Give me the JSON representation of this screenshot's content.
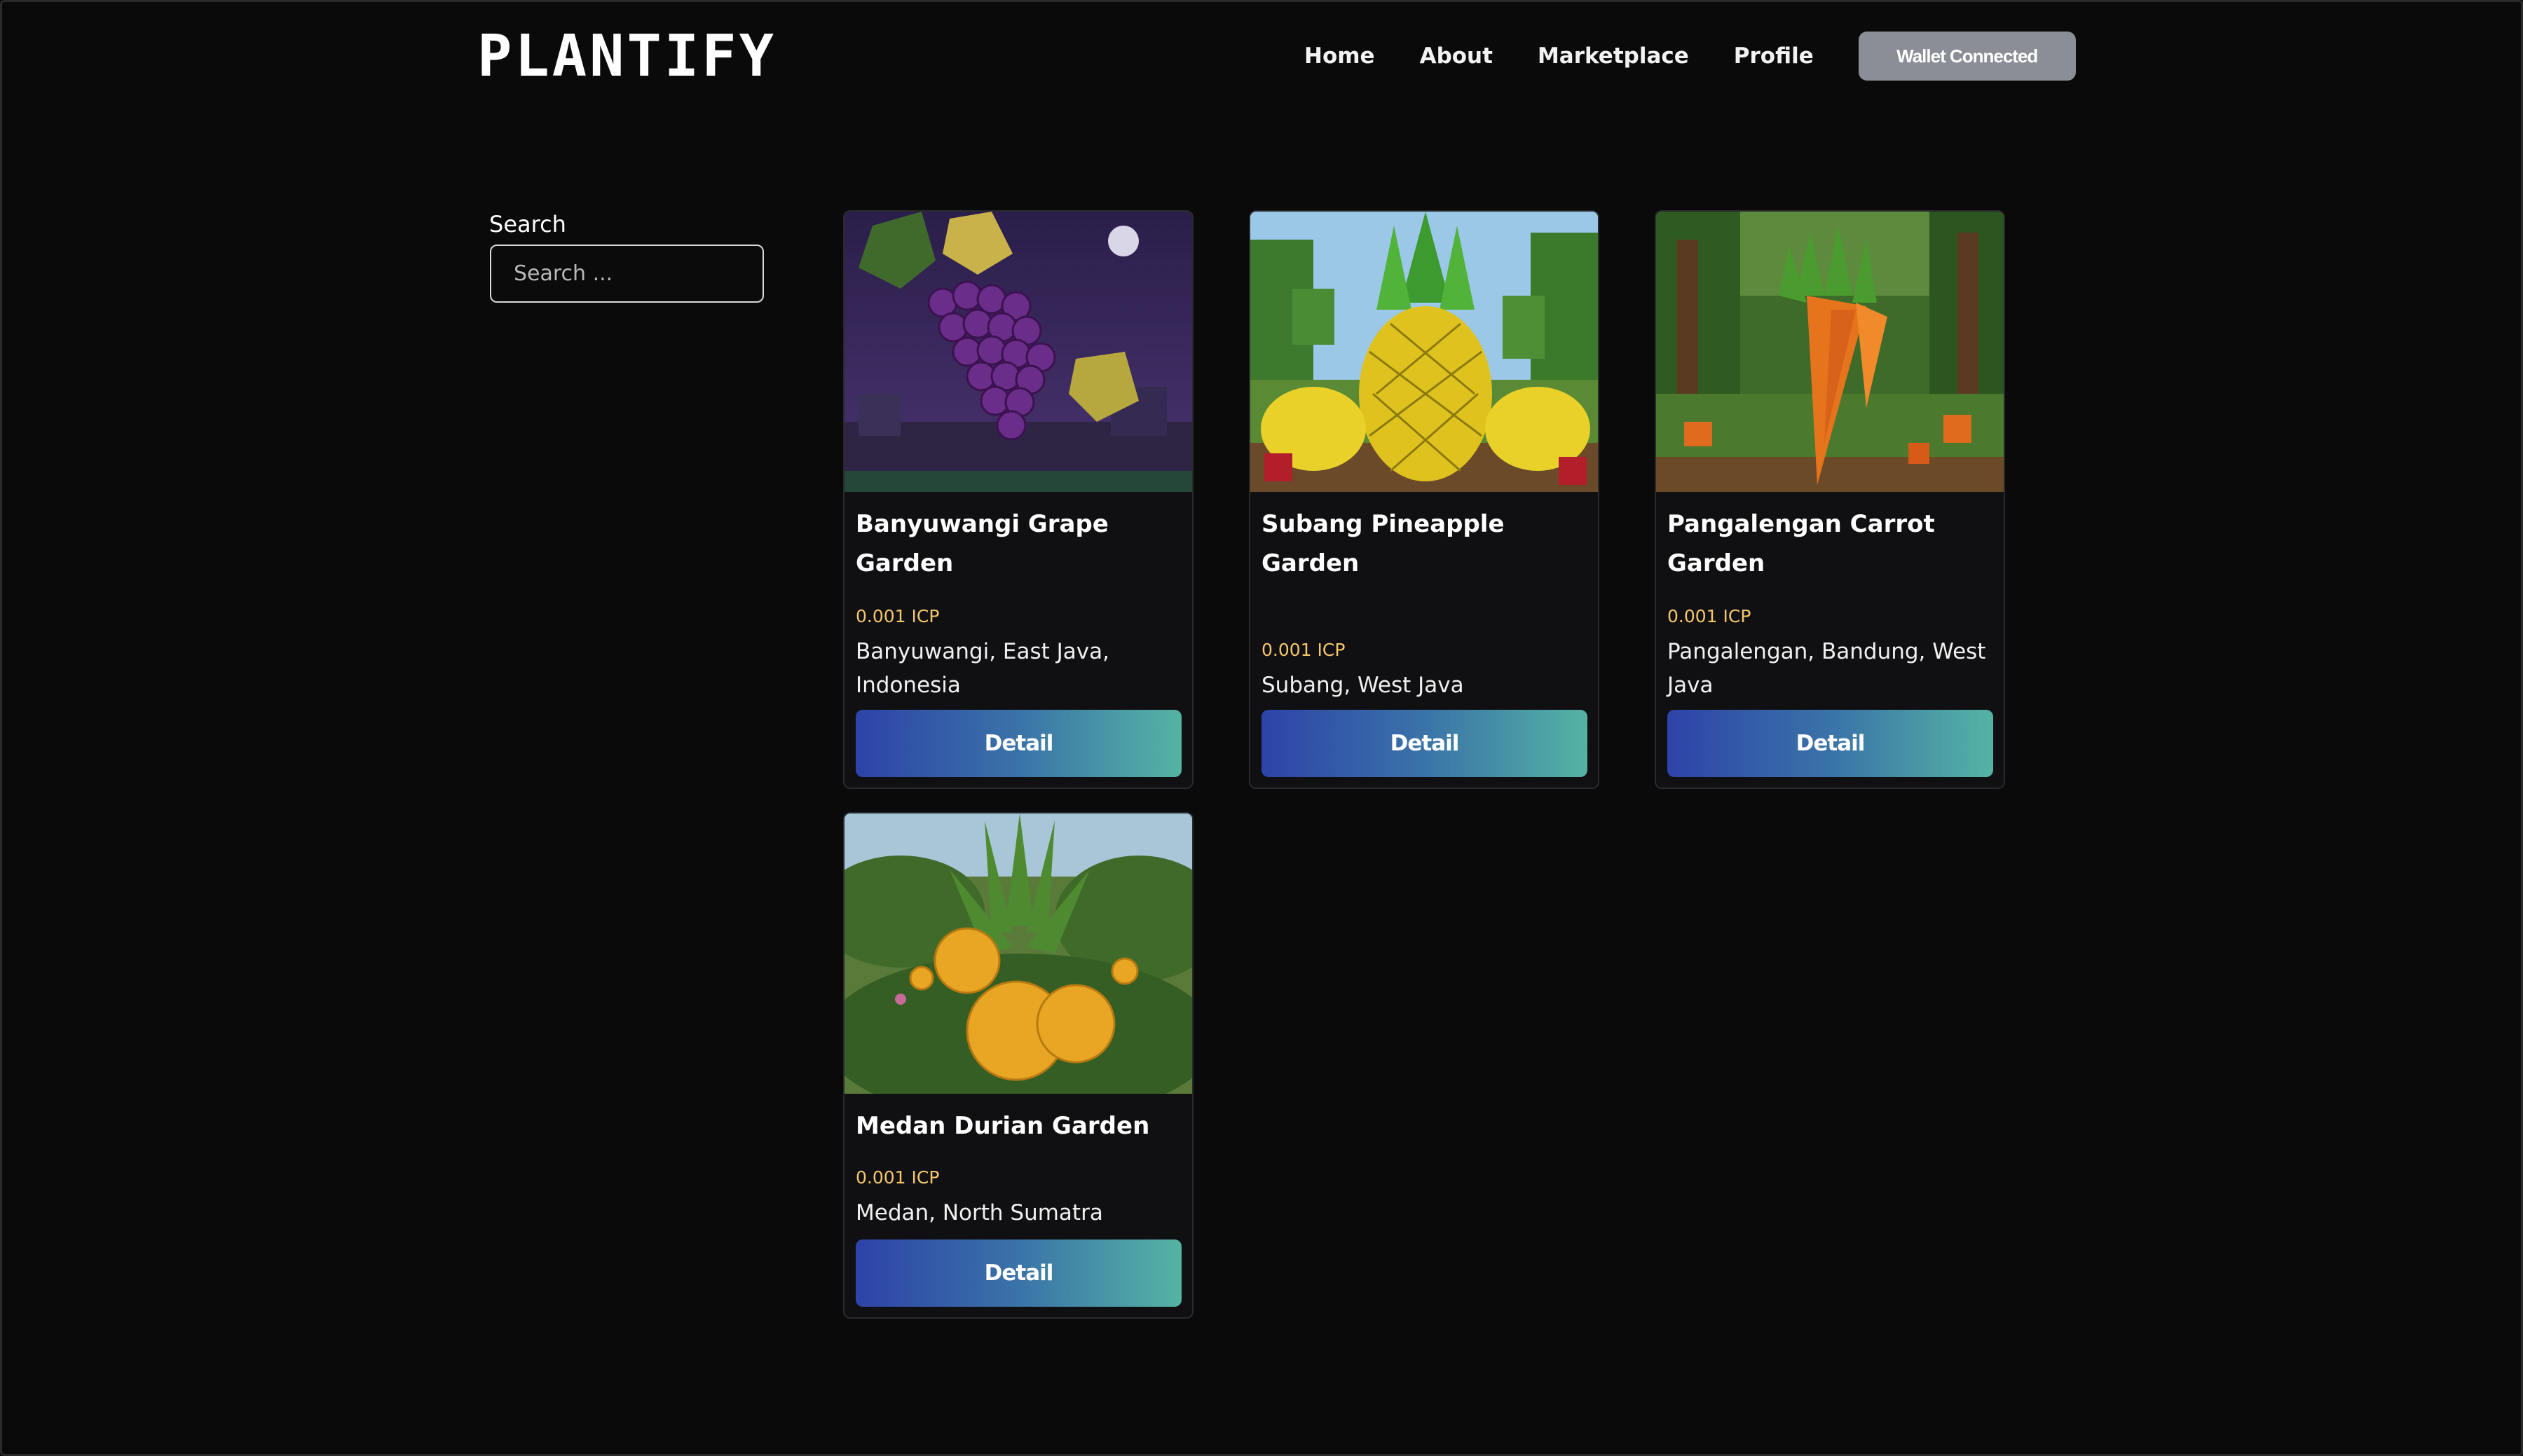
{
  "brand": {
    "logo": "PLANTIFY"
  },
  "nav": {
    "items": [
      "Home",
      "About",
      "Marketplace",
      "Profile"
    ],
    "wallet_button": "Wallet Connected"
  },
  "search": {
    "label": "Search",
    "placeholder": "Search ..."
  },
  "listings": [
    {
      "title": "Banyuwangi Grape Garden",
      "price": "0.001 ICP",
      "location": "Banyuwangi, East Java, Indonesia",
      "button": "Detail",
      "image": "grape-image"
    },
    {
      "title": "Subang Pineapple Garden",
      "price": "0.001 ICP",
      "location": "Subang, West Java",
      "button": "Detail",
      "image": "pineapple-image"
    },
    {
      "title": "Pangalengan Carrot Garden",
      "price": "0.001 ICP",
      "location": "Pangalengan, Bandung, West Java",
      "button": "Detail",
      "image": "carrot-image"
    },
    {
      "title": "Medan Durian Garden",
      "price": "0.001 ICP",
      "location": "Medan, North Sumatra",
      "button": "Detail",
      "image": "durian-image"
    }
  ],
  "colors": {
    "background": "#0a0a0a",
    "price": "#f5c76a",
    "wallet_button": "#8b8e96",
    "gradient_start": "#2e43a8",
    "gradient_end": "#55b3a3"
  }
}
